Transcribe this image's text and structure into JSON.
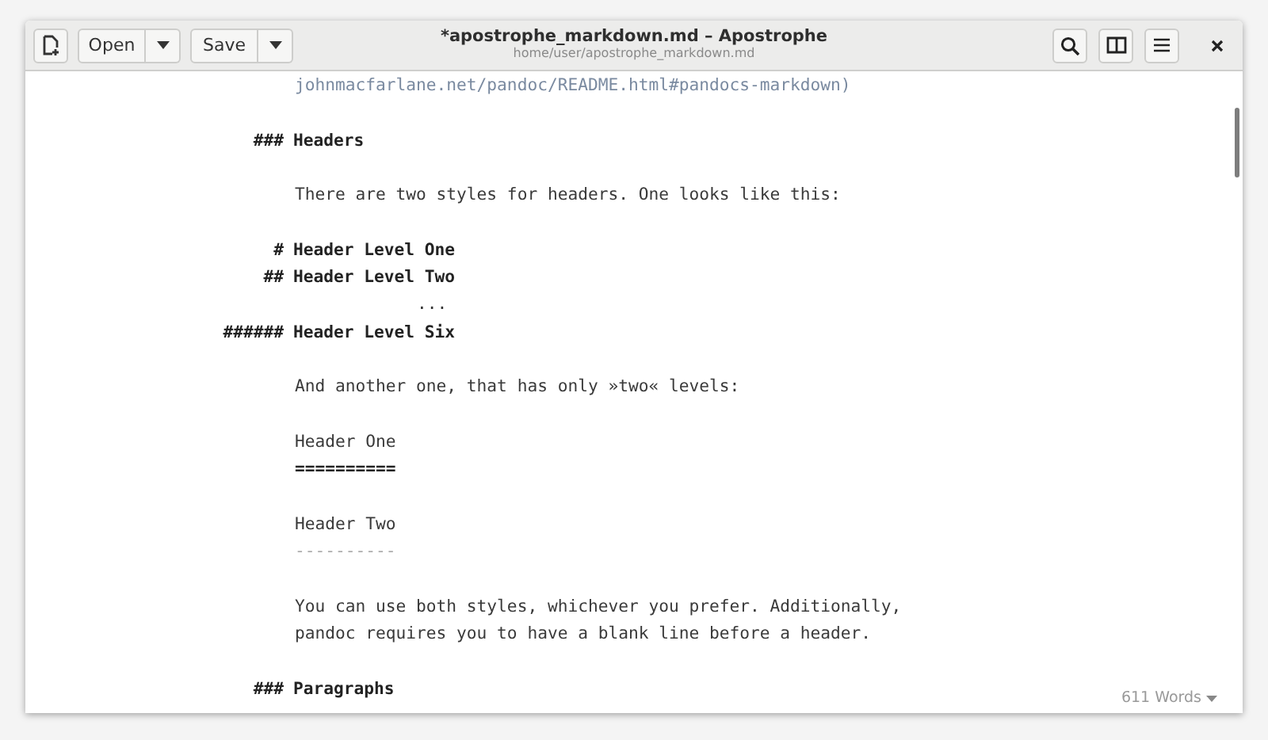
{
  "window": {
    "title": "*apostrophe_markdown.md – Apostrophe",
    "subtitle": "home/user/apostrophe_markdown.md"
  },
  "toolbar": {
    "open": "Open",
    "save": "Save"
  },
  "lines": [
    {
      "kind": "link",
      "text": "johnmacfarlane.net/pandoc/README.html#pandocs-markdown)"
    },
    {
      "kind": "blank"
    },
    {
      "kind": "heading",
      "prefix": "###",
      "text": "Headers"
    },
    {
      "kind": "blank"
    },
    {
      "kind": "text",
      "text": "There are two styles for headers. One looks like this:"
    },
    {
      "kind": "blank"
    },
    {
      "kind": "heading",
      "prefix": "#",
      "text": "Header Level One"
    },
    {
      "kind": "heading",
      "prefix": "##",
      "text": "Header Level Two"
    },
    {
      "kind": "ellipsis",
      "text": "..."
    },
    {
      "kind": "heading",
      "prefix": "######",
      "text": "Header Level Six"
    },
    {
      "kind": "blank"
    },
    {
      "kind": "text",
      "text": "And another one, that has only »two« levels:"
    },
    {
      "kind": "blank"
    },
    {
      "kind": "text",
      "text": "Header One"
    },
    {
      "kind": "rule",
      "text": "==========",
      "muted": false
    },
    {
      "kind": "blank"
    },
    {
      "kind": "text",
      "text": "Header Two"
    },
    {
      "kind": "rule",
      "text": "----------",
      "muted": true
    },
    {
      "kind": "blank"
    },
    {
      "kind": "text",
      "text": "You can use both styles, whichever you prefer. Additionally,"
    },
    {
      "kind": "text",
      "text": "pandoc requires you to have a blank line before a header."
    },
    {
      "kind": "blank"
    },
    {
      "kind": "heading",
      "prefix": "###",
      "text": "Paragraphs"
    }
  ],
  "status": {
    "word_count": "611 Words"
  }
}
